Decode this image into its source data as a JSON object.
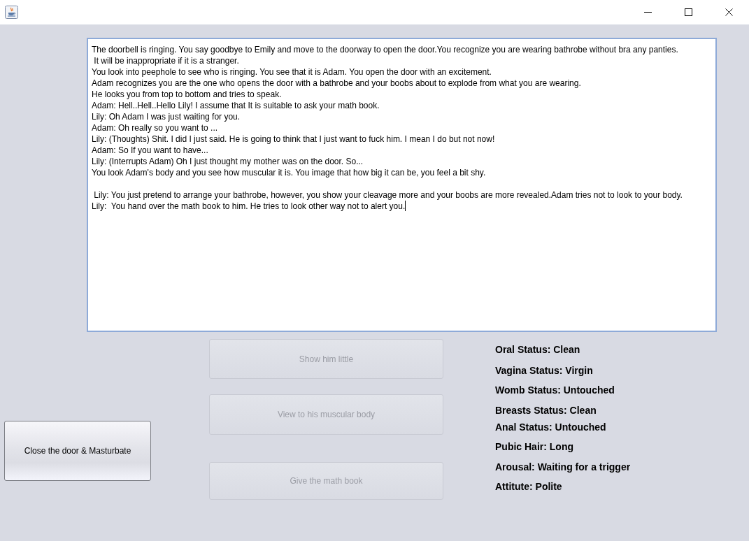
{
  "story": {
    "text": "The doorbell is ringing. You say goodbye to Emily and move to the doorway to open the door.You recognize you are wearing bathrobe without bra any panties.\n It will be inappropriate if it is a stranger.\nYou look into peephole to see who is ringing. You see that it is Adam. You open the door with an excitement.\nAdam recognizes you are the one who opens the door with a bathrobe and your boobs about to explode from what you are wearing.\nHe looks you from top to bottom and tries to speak.\nAdam: Hell..Hell..Hello Lily! I assume that It is suitable to ask your math book.\nLily: Oh Adam I was just waiting for you.\nAdam: Oh really so you want to ...\nLily: (Thoughts) Shit. I did I just said. He is going to think that I just want to fuck him. I mean I do but not now!\nAdam: So If you want to have...\nLily: (Interrupts Adam) Oh I just thought my mother was on the door. So...\nYou look Adam's body and you see how muscular it is. You image that how big it can be, you feel a bit shy.\n\n Lily: You just pretend to arrange your bathrobe, however, you show your cleavage more and your boobs are more revealed.Adam tries not to look to your body.\nLily:  You hand over the math book to him. He tries to look other way not to alert you."
  },
  "side_action": {
    "label": "Close the door & Masturbate",
    "disabled": false
  },
  "choices": [
    {
      "label": "Show him little",
      "disabled": true
    },
    {
      "label": "View to his muscular body",
      "disabled": true
    },
    {
      "label": "Give the math book",
      "disabled": true
    }
  ],
  "stats": [
    "Oral Status: Clean",
    "Vagina Status: Virgin",
    "Womb Status: Untouched",
    "Breasts Status: Clean",
    "Anal Status: Untouched",
    "Pubic Hair: Long",
    "Arousal: Waiting for a trigger",
    "Attitute: Polite"
  ]
}
